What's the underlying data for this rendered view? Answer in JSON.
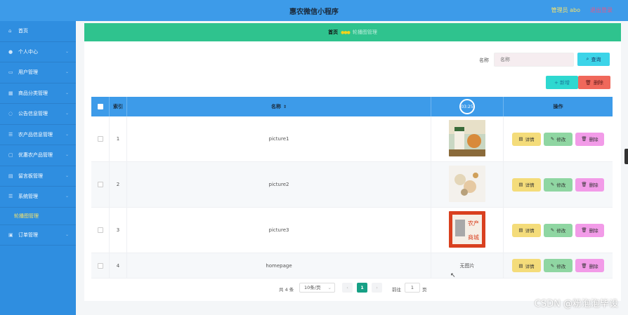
{
  "header": {
    "title": "惠农微信小程序",
    "admin": "管理员 abo",
    "logout": "退出登录"
  },
  "sidebar": {
    "items": [
      {
        "label": "首页",
        "icon": "home-icon",
        "glyph": "⌂",
        "has_children": false
      },
      {
        "label": "个人中心",
        "icon": "user-icon",
        "glyph": "●",
        "has_children": true
      },
      {
        "label": "用户管理",
        "icon": "users-icon",
        "glyph": "▭",
        "has_children": true
      },
      {
        "label": "商品分类管理",
        "icon": "category-icon",
        "glyph": "▦",
        "has_children": true
      },
      {
        "label": "公告信息管理",
        "icon": "notice-icon",
        "glyph": "◌",
        "has_children": true
      },
      {
        "label": "农产品信息管理",
        "icon": "list-icon",
        "glyph": "☰",
        "has_children": true
      },
      {
        "label": "优惠农产品管理",
        "icon": "discount-icon",
        "glyph": "▢",
        "has_children": true
      },
      {
        "label": "留言板管理",
        "icon": "message-icon",
        "glyph": "▤",
        "has_children": true
      },
      {
        "label": "系统管理",
        "icon": "settings-icon",
        "glyph": "☰",
        "has_children": true
      }
    ],
    "submenu": {
      "label": "轮播图管理"
    },
    "last_item": {
      "label": "订单管理",
      "icon": "order-icon",
      "glyph": "▣"
    }
  },
  "breadcrumb": {
    "home": "首页",
    "separator": "●●●",
    "current": "轮播图管理"
  },
  "search": {
    "label": "名称",
    "placeholder": "名称",
    "query_button": "查询"
  },
  "toolbar": {
    "add_button": "+ 新增",
    "delete_button": "删除"
  },
  "table": {
    "headers": {
      "index": "索引",
      "name": "名称",
      "image_badge": "03:25",
      "actions": "操作"
    },
    "rows": [
      {
        "index": "1",
        "name": "picture1",
        "image": "photo",
        "image_icon": "picture1-thumbnail"
      },
      {
        "index": "2",
        "name": "picture2",
        "image": "photo",
        "image_icon": "picture2-thumbnail"
      },
      {
        "index": "3",
        "name": "picture3",
        "image": "photo",
        "image_icon": "picture3-thumbnail"
      },
      {
        "index": "4",
        "name": "homepage",
        "image": "none",
        "no_image_text": "无图片"
      }
    ],
    "action_labels": {
      "detail": "详情",
      "edit": "修改",
      "delete": "删除"
    }
  },
  "pagination": {
    "total": "共 4 条",
    "page_size": "10条/页",
    "current_page": "1",
    "goto_prefix": "前往",
    "goto_value": "1",
    "goto_suffix": "页"
  },
  "watermark": "CSDN @粉泡泡毕设",
  "colors": {
    "header": "#3d9be9",
    "sidebar": "#2f8ee0",
    "breadcrumb": "#2fc38e",
    "active_menu": "#f7e36a",
    "page_active": "#16a085"
  }
}
